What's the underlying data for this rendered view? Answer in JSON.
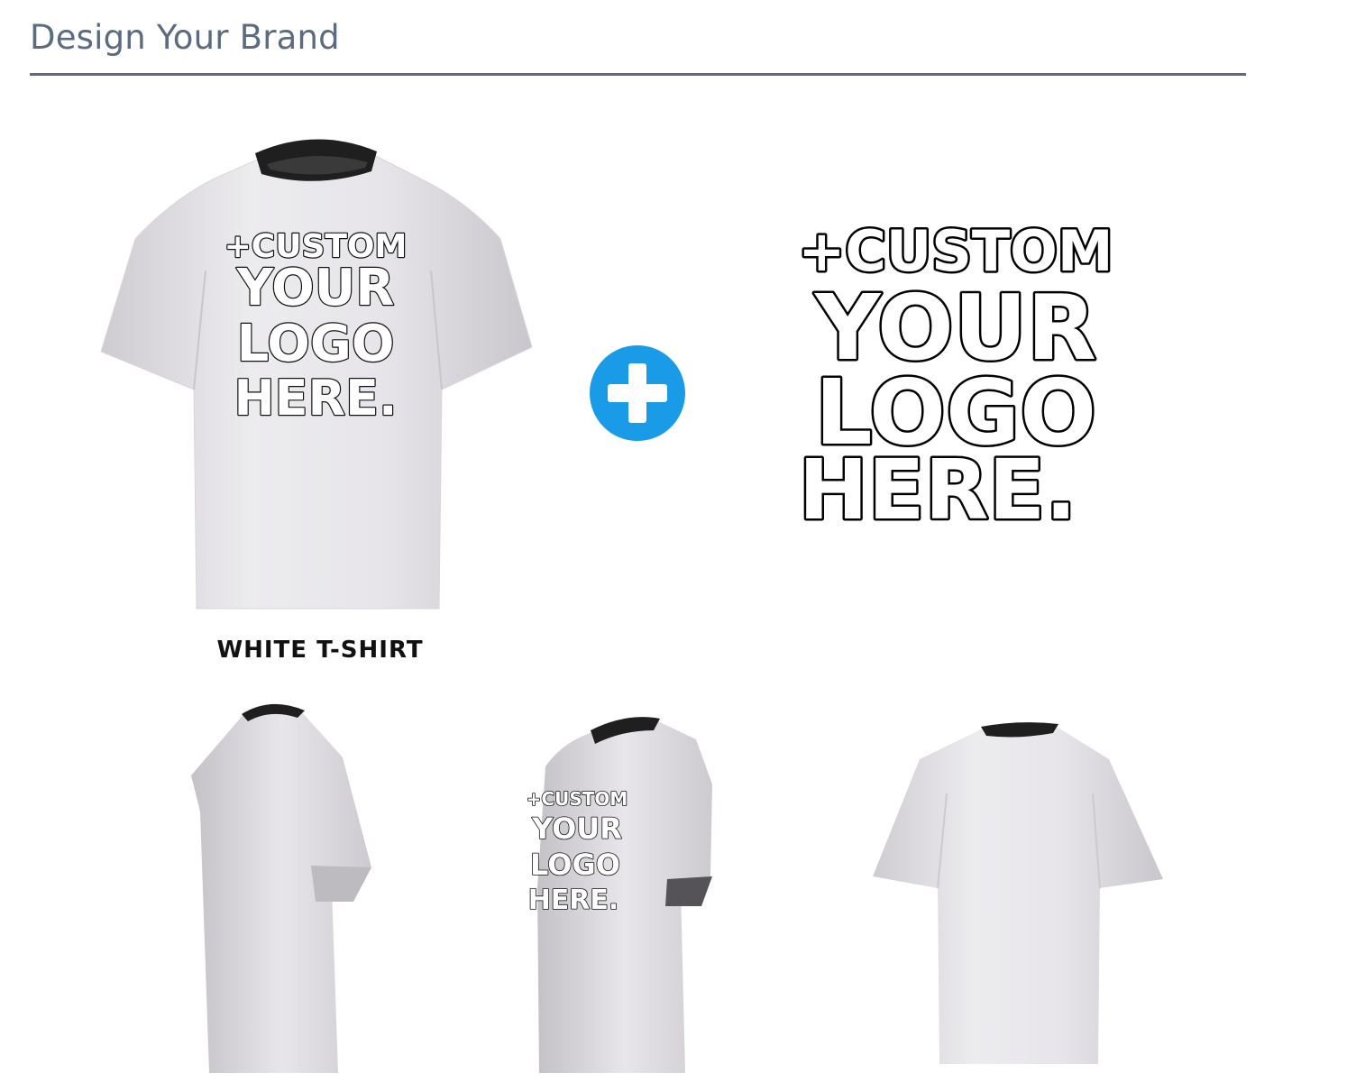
{
  "header": {
    "title": "Design Your Brand"
  },
  "colors": {
    "title": "#5b6b80",
    "accent": "#1a9be8",
    "shirt": "#e6e3e6",
    "collar": "#1f1f1f"
  },
  "product": {
    "label": "WHITE T-SHIRT"
  },
  "logo_art": {
    "lines": [
      "+CUSTOM",
      "YOUR",
      "LOGO",
      "HERE."
    ]
  },
  "icons": {
    "add": "plus-circle-icon"
  }
}
